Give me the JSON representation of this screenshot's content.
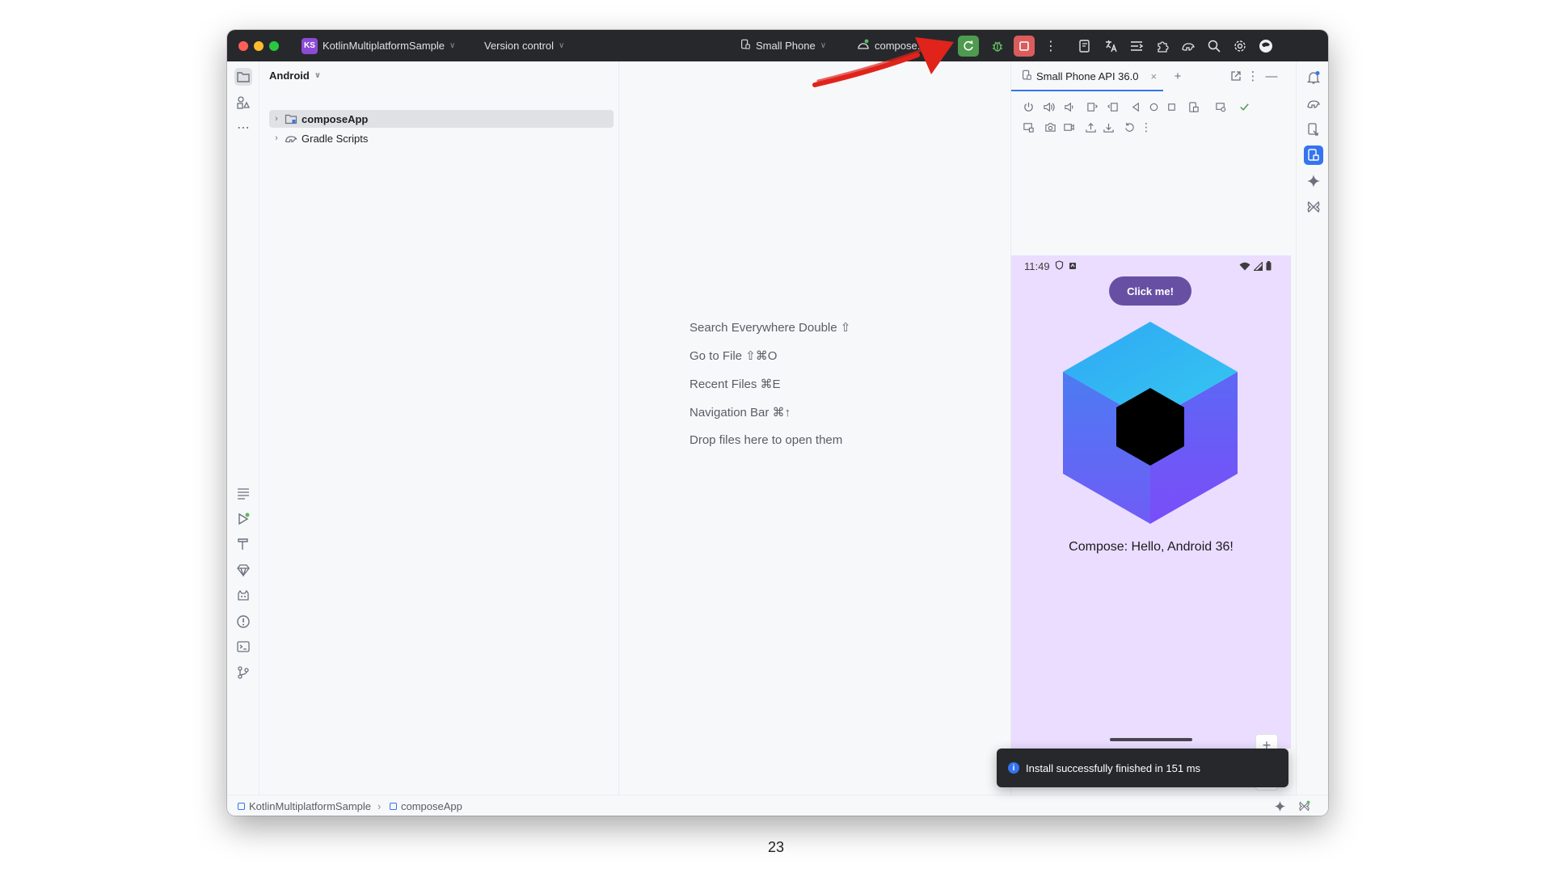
{
  "titlebar": {
    "project_initials": "KS",
    "project_name": "KotlinMultiplatformSample",
    "version_control": "Version control",
    "device": "Small Phone",
    "run_config": "compose..."
  },
  "sidebar": {
    "header": "Android",
    "tree": [
      {
        "label": "composeApp",
        "selected": true
      },
      {
        "label": "Gradle Scripts",
        "selected": false
      }
    ]
  },
  "editor": {
    "hints": [
      "Search Everywhere Double ⇧",
      "Go to File ⇧⌘O",
      "Recent Files ⌘E",
      "Navigation Bar ⌘↑",
      "Drop files here to open them"
    ]
  },
  "devices": {
    "tab_label": "Small Phone API 36.0",
    "phone": {
      "time": "11:49",
      "button_label": "Click me!",
      "message": "Compose: Hello, Android 36!"
    },
    "zoom": {
      "plus": "+",
      "minus": "—"
    }
  },
  "statusbar": {
    "breadcrumbs": [
      "KotlinMultiplatformSample",
      "composeApp"
    ]
  },
  "toast": {
    "message": "Install successfully finished in 151 ms"
  },
  "page_number": "23",
  "colors": {
    "titlebar": "#27282c",
    "accent": "#3574f0",
    "run_button": "#4e9a4e",
    "stop_button": "#db5c5c",
    "phone_bg": "#eaddff",
    "phone_button": "#6750a4",
    "annotation_arrow": "#e0241b"
  }
}
